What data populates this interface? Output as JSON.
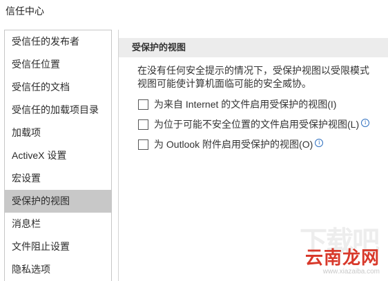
{
  "window": {
    "title": "信任中心"
  },
  "sidebar": {
    "items": [
      {
        "label": "受信任的发布者"
      },
      {
        "label": "受信任位置"
      },
      {
        "label": "受信任的文档"
      },
      {
        "label": "受信任的加载项目录"
      },
      {
        "label": "加载项"
      },
      {
        "label": "ActiveX 设置"
      },
      {
        "label": "宏设置"
      },
      {
        "label": "受保护的视图",
        "selected": true
      },
      {
        "label": "消息栏"
      },
      {
        "label": "文件阻止设置"
      },
      {
        "label": "隐私选项"
      }
    ]
  },
  "content": {
    "section_title": "受保护的视图",
    "description_line1": "在没有任何安全提示的情况下，受保护视图以受限模式",
    "description_line2": "视图可能使计算机面临可能的安全威协。",
    "options": [
      {
        "label": "为来自 Internet 的文件启用受保护的视图(I)",
        "checked": false,
        "info_icon": false
      },
      {
        "label": "为位于可能不安全位置的文件启用受保护视图(L)",
        "checked": false,
        "info_icon": true
      },
      {
        "label": "为 Outlook 附件启用受保护的视图(O)",
        "checked": false,
        "info_icon": true
      }
    ],
    "info_icon_glyph": "i"
  },
  "watermark": {
    "ghost_text": "下载吧",
    "brand": "云南龙网",
    "url": "www.xiazaiba.com"
  },
  "colors": {
    "selected_bg": "#c8c8c8",
    "section_header_bg": "#ececec",
    "info_blue": "#2e6fbf",
    "brand_red": "#d8392b"
  }
}
